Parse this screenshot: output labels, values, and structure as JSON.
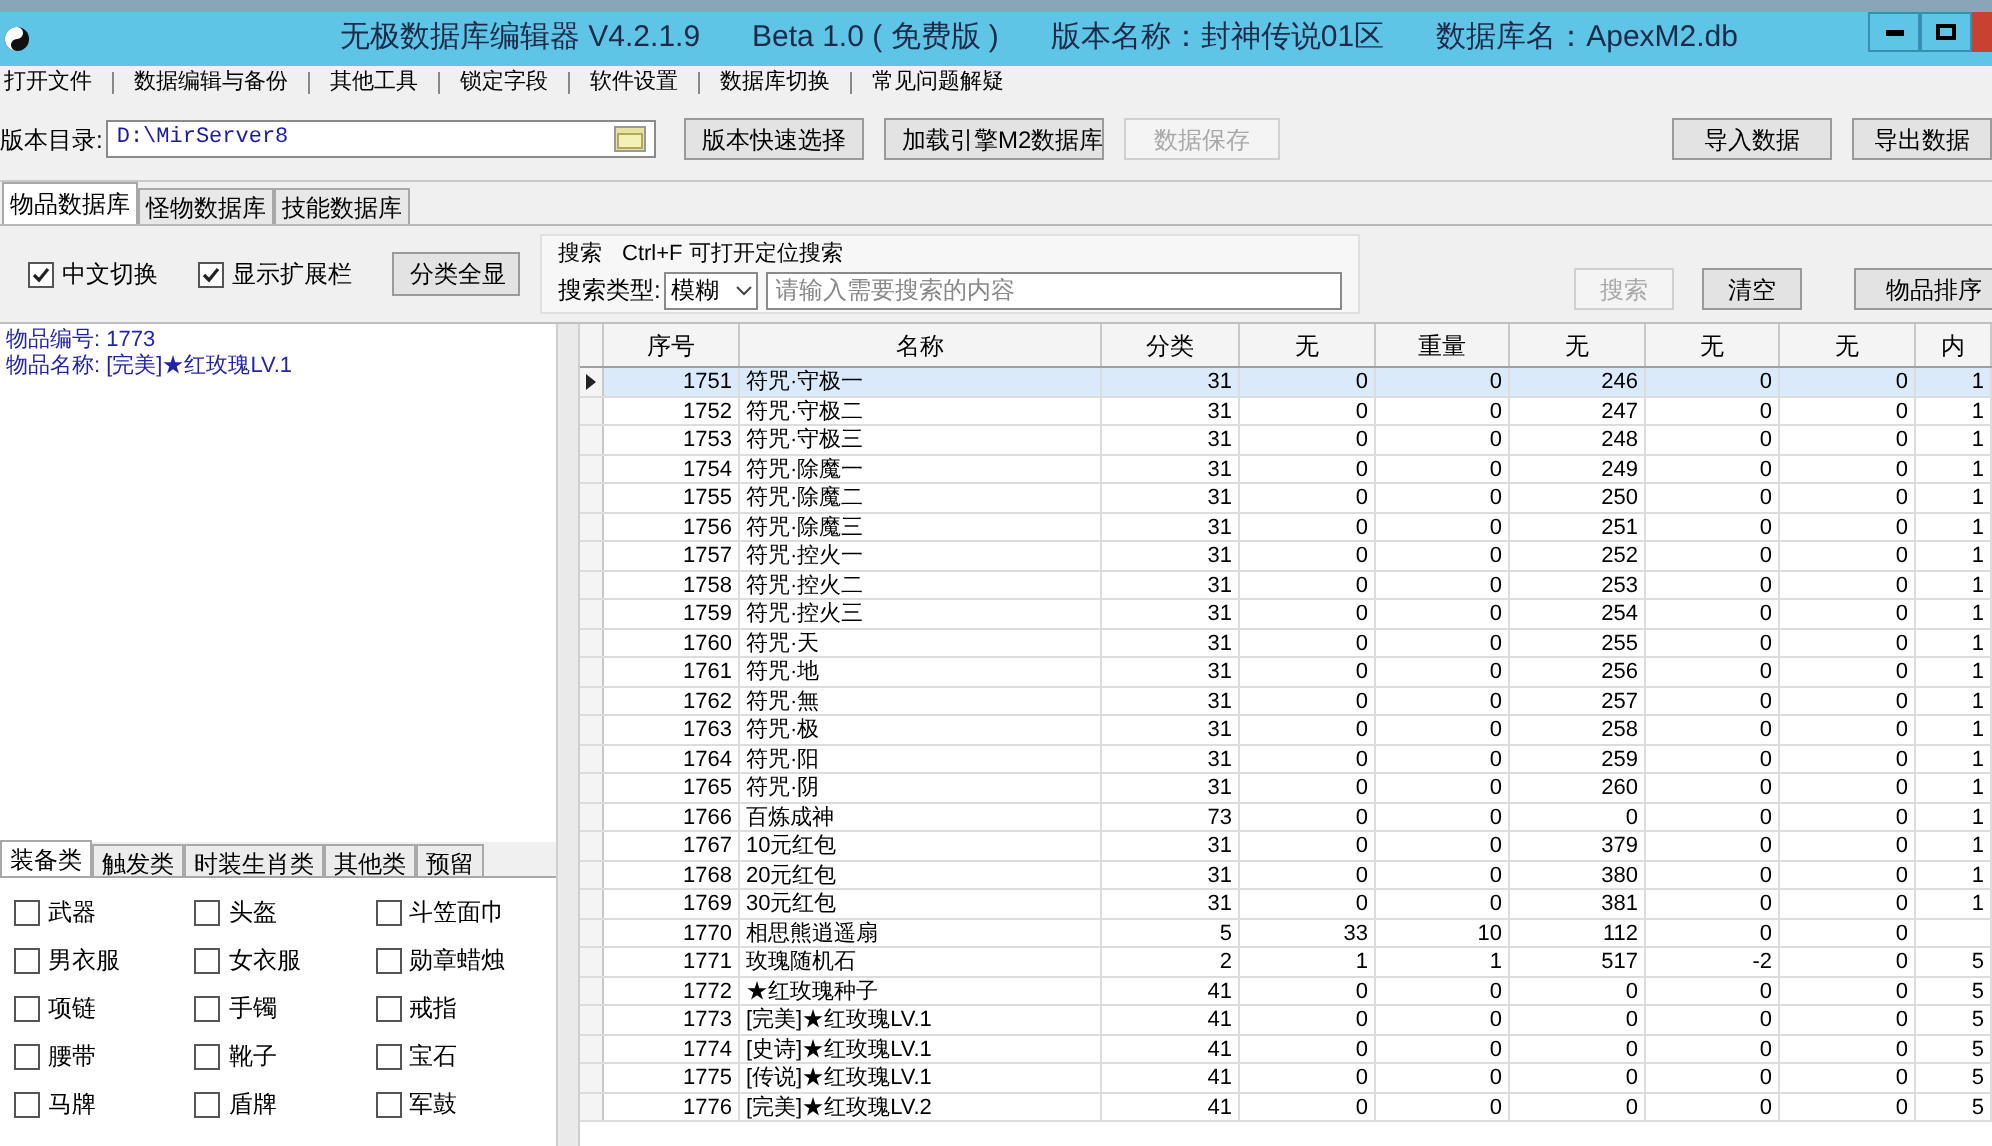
{
  "window": {
    "title_parts": [
      "无极数据库编辑器 V4.2.1.9",
      "Beta 1.0 ( 免费版 )",
      "版本名称：封神传说01区",
      "数据库名：ApexM2.db"
    ]
  },
  "menu": [
    "打开文件",
    "数据编辑与备份",
    "其他工具",
    "锁定字段",
    "软件设置",
    "数据库切换",
    "常见问题解疑"
  ],
  "version_row": {
    "label": "版本目录:",
    "path": "D:\\MirServer8",
    "buttons": [
      {
        "label": "版本快速选择",
        "disabled": false
      },
      {
        "label": "加载引擎M2数据库",
        "disabled": false
      },
      {
        "label": "数据保存",
        "disabled": true
      },
      {
        "label": "导入数据",
        "disabled": false
      },
      {
        "label": "导出数据",
        "disabled": false
      }
    ]
  },
  "tabs": [
    {
      "label": "物品数据库",
      "selected": true
    },
    {
      "label": "怪物数据库",
      "selected": false
    },
    {
      "label": "技能数据库",
      "selected": false
    }
  ],
  "options": {
    "checkboxes": [
      {
        "label": "中文切换",
        "checked": true
      },
      {
        "label": "显示扩展栏",
        "checked": true
      }
    ],
    "show_all_button": "分类全显"
  },
  "search": {
    "title": "搜索",
    "hint": "Ctrl+F 可打开定位搜索",
    "type_label": "搜索类型:",
    "type_value": "模糊",
    "placeholder": "请输入需要搜索的内容",
    "search_button": {
      "label": "搜索",
      "disabled": true
    },
    "clear_button": "清空"
  },
  "sort_button": "物品排序",
  "info": [
    "物品编号: 1773",
    "物品名称: [完美]★红玫瑰LV.1"
  ],
  "category_tabs": [
    {
      "label": "装备类",
      "selected": true
    },
    {
      "label": "触发类",
      "selected": false
    },
    {
      "label": "时装生肖类",
      "selected": false
    },
    {
      "label": "其他类",
      "selected": false
    },
    {
      "label": "预留",
      "selected": false
    }
  ],
  "categories": [
    {
      "label": "武器",
      "checked": false
    },
    {
      "label": "头盔",
      "checked": false
    },
    {
      "label": "斗笠面巾",
      "checked": false
    },
    {
      "label": "男衣服",
      "checked": false
    },
    {
      "label": "女衣服",
      "checked": false
    },
    {
      "label": "勋章蜡烛",
      "checked": false
    },
    {
      "label": "项链",
      "checked": false
    },
    {
      "label": "手镯",
      "checked": false
    },
    {
      "label": "戒指",
      "checked": false
    },
    {
      "label": "腰带",
      "checked": false
    },
    {
      "label": "靴子",
      "checked": false
    },
    {
      "label": "宝石",
      "checked": false
    },
    {
      "label": "马牌",
      "checked": false
    },
    {
      "label": "盾牌",
      "checked": false
    },
    {
      "label": "军鼓",
      "checked": false
    }
  ],
  "table": {
    "columns": [
      "序号",
      "名称",
      "分类",
      "无",
      "重量",
      "无",
      "无",
      "无",
      "内"
    ],
    "rows": [
      {
        "selected": true,
        "cells": [
          "1751",
          "符咒·守极一",
          "31",
          "0",
          "0",
          "246",
          "0",
          "0",
          "1"
        ]
      },
      {
        "selected": false,
        "cells": [
          "1752",
          "符咒·守极二",
          "31",
          "0",
          "0",
          "247",
          "0",
          "0",
          "1"
        ]
      },
      {
        "selected": false,
        "cells": [
          "1753",
          "符咒·守极三",
          "31",
          "0",
          "0",
          "248",
          "0",
          "0",
          "1"
        ]
      },
      {
        "selected": false,
        "cells": [
          "1754",
          "符咒·除魔一",
          "31",
          "0",
          "0",
          "249",
          "0",
          "0",
          "1"
        ]
      },
      {
        "selected": false,
        "cells": [
          "1755",
          "符咒·除魔二",
          "31",
          "0",
          "0",
          "250",
          "0",
          "0",
          "1"
        ]
      },
      {
        "selected": false,
        "cells": [
          "1756",
          "符咒·除魔三",
          "31",
          "0",
          "0",
          "251",
          "0",
          "0",
          "1"
        ]
      },
      {
        "selected": false,
        "cells": [
          "1757",
          "符咒·控火一",
          "31",
          "0",
          "0",
          "252",
          "0",
          "0",
          "1"
        ]
      },
      {
        "selected": false,
        "cells": [
          "1758",
          "符咒·控火二",
          "31",
          "0",
          "0",
          "253",
          "0",
          "0",
          "1"
        ]
      },
      {
        "selected": false,
        "cells": [
          "1759",
          "符咒·控火三",
          "31",
          "0",
          "0",
          "254",
          "0",
          "0",
          "1"
        ]
      },
      {
        "selected": false,
        "cells": [
          "1760",
          "符咒·天",
          "31",
          "0",
          "0",
          "255",
          "0",
          "0",
          "1"
        ]
      },
      {
        "selected": false,
        "cells": [
          "1761",
          "符咒·地",
          "31",
          "0",
          "0",
          "256",
          "0",
          "0",
          "1"
        ]
      },
      {
        "selected": false,
        "cells": [
          "1762",
          "符咒·無",
          "31",
          "0",
          "0",
          "257",
          "0",
          "0",
          "1"
        ]
      },
      {
        "selected": false,
        "cells": [
          "1763",
          "符咒·极",
          "31",
          "0",
          "0",
          "258",
          "0",
          "0",
          "1"
        ]
      },
      {
        "selected": false,
        "cells": [
          "1764",
          "符咒·阳",
          "31",
          "0",
          "0",
          "259",
          "0",
          "0",
          "1"
        ]
      },
      {
        "selected": false,
        "cells": [
          "1765",
          "符咒·阴",
          "31",
          "0",
          "0",
          "260",
          "0",
          "0",
          "1"
        ]
      },
      {
        "selected": false,
        "cells": [
          "1766",
          "百炼成神",
          "73",
          "0",
          "0",
          "0",
          "0",
          "0",
          "1"
        ]
      },
      {
        "selected": false,
        "cells": [
          "1767",
          "10元红包",
          "31",
          "0",
          "0",
          "379",
          "0",
          "0",
          "1"
        ]
      },
      {
        "selected": false,
        "cells": [
          "1768",
          "20元红包",
          "31",
          "0",
          "0",
          "380",
          "0",
          "0",
          "1"
        ]
      },
      {
        "selected": false,
        "cells": [
          "1769",
          "30元红包",
          "31",
          "0",
          "0",
          "381",
          "0",
          "0",
          "1"
        ]
      },
      {
        "selected": false,
        "cells": [
          "1770",
          "相思熊逍遥扇",
          "5",
          "33",
          "10",
          "112",
          "0",
          "0",
          ""
        ]
      },
      {
        "selected": false,
        "cells": [
          "1771",
          "玫瑰随机石",
          "2",
          "1",
          "1",
          "517",
          "-2",
          "0",
          "5"
        ]
      },
      {
        "selected": false,
        "cells": [
          "1772",
          "★红玫瑰种子",
          "41",
          "0",
          "0",
          "0",
          "0",
          "0",
          "5"
        ]
      },
      {
        "selected": false,
        "cells": [
          "1773",
          "[完美]★红玫瑰LV.1",
          "41",
          "0",
          "0",
          "0",
          "0",
          "0",
          "5"
        ]
      },
      {
        "selected": false,
        "cells": [
          "1774",
          "[史诗]★红玫瑰LV.1",
          "41",
          "0",
          "0",
          "0",
          "0",
          "0",
          "5"
        ]
      },
      {
        "selected": false,
        "cells": [
          "1775",
          "[传说]★红玫瑰LV.1",
          "41",
          "0",
          "0",
          "0",
          "0",
          "0",
          "5"
        ]
      },
      {
        "selected": false,
        "cells": [
          "1776",
          "[完美]★红玫瑰LV.2",
          "41",
          "0",
          "0",
          "0",
          "0",
          "0",
          "5"
        ]
      }
    ]
  }
}
